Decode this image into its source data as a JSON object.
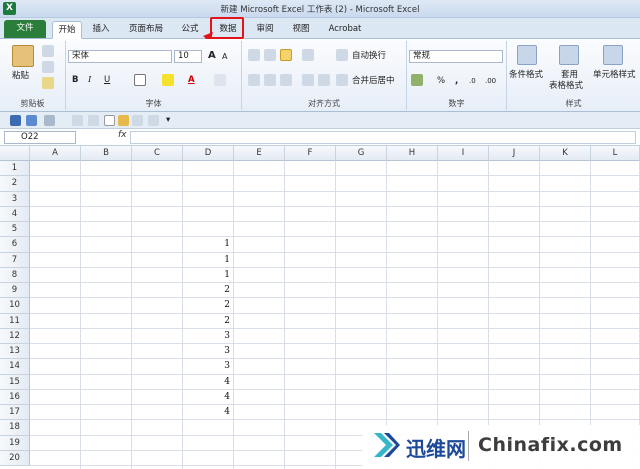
{
  "window": {
    "title": "新建 Microsoft Excel 工作表 (2)  -  Microsoft Excel",
    "logo": "X"
  },
  "tabs": [
    "文件",
    "开始",
    "插入",
    "页面布局",
    "公式",
    "数据",
    "审阅",
    "视图",
    "Acrobat"
  ],
  "ribbon": {
    "paste": "粘贴",
    "clipboard": "剪贴板",
    "font_name": "宋体",
    "font_size": "10",
    "font_group": "字体",
    "align_group": "对齐方式",
    "wrap_text": "自动换行",
    "merge_center": "合并后居中",
    "number_format": "常规",
    "number_group": "数字",
    "cond_format": "条件格式",
    "table_format_1": "套用",
    "table_format_2": "表格格式",
    "cell_styles": "单元格样式",
    "styles_group": "样式",
    "bold": "B",
    "italic": "I",
    "underline": "U",
    "font_grow": "A",
    "font_shrink": "A",
    "percent": "%",
    "comma": ",",
    "increase_dec": ".0",
    "decrease_dec": ".00"
  },
  "formula_bar": {
    "name_box": "O22",
    "fx": "fx",
    "value": ""
  },
  "columns": [
    "A",
    "B",
    "C",
    "D",
    "E",
    "F",
    "G",
    "H",
    "I",
    "J",
    "K",
    "L"
  ],
  "rows": [
    "1",
    "2",
    "3",
    "4",
    "5",
    "6",
    "7",
    "8",
    "9",
    "10",
    "11",
    "12",
    "13",
    "14",
    "15",
    "16",
    "17",
    "18",
    "19",
    "20"
  ],
  "column_d": [
    "",
    "",
    "",
    "",
    "",
    "1",
    "1",
    "1",
    "2",
    "2",
    "2",
    "3",
    "3",
    "3",
    "4",
    "4",
    "4",
    "",
    "",
    ""
  ],
  "watermark": {
    "brand": "迅维网",
    "site": "Chinafix.com"
  },
  "colors": {
    "file_tab": "#2a7d3a",
    "highlight": "#e3131b",
    "accent": "#1c4a99"
  }
}
